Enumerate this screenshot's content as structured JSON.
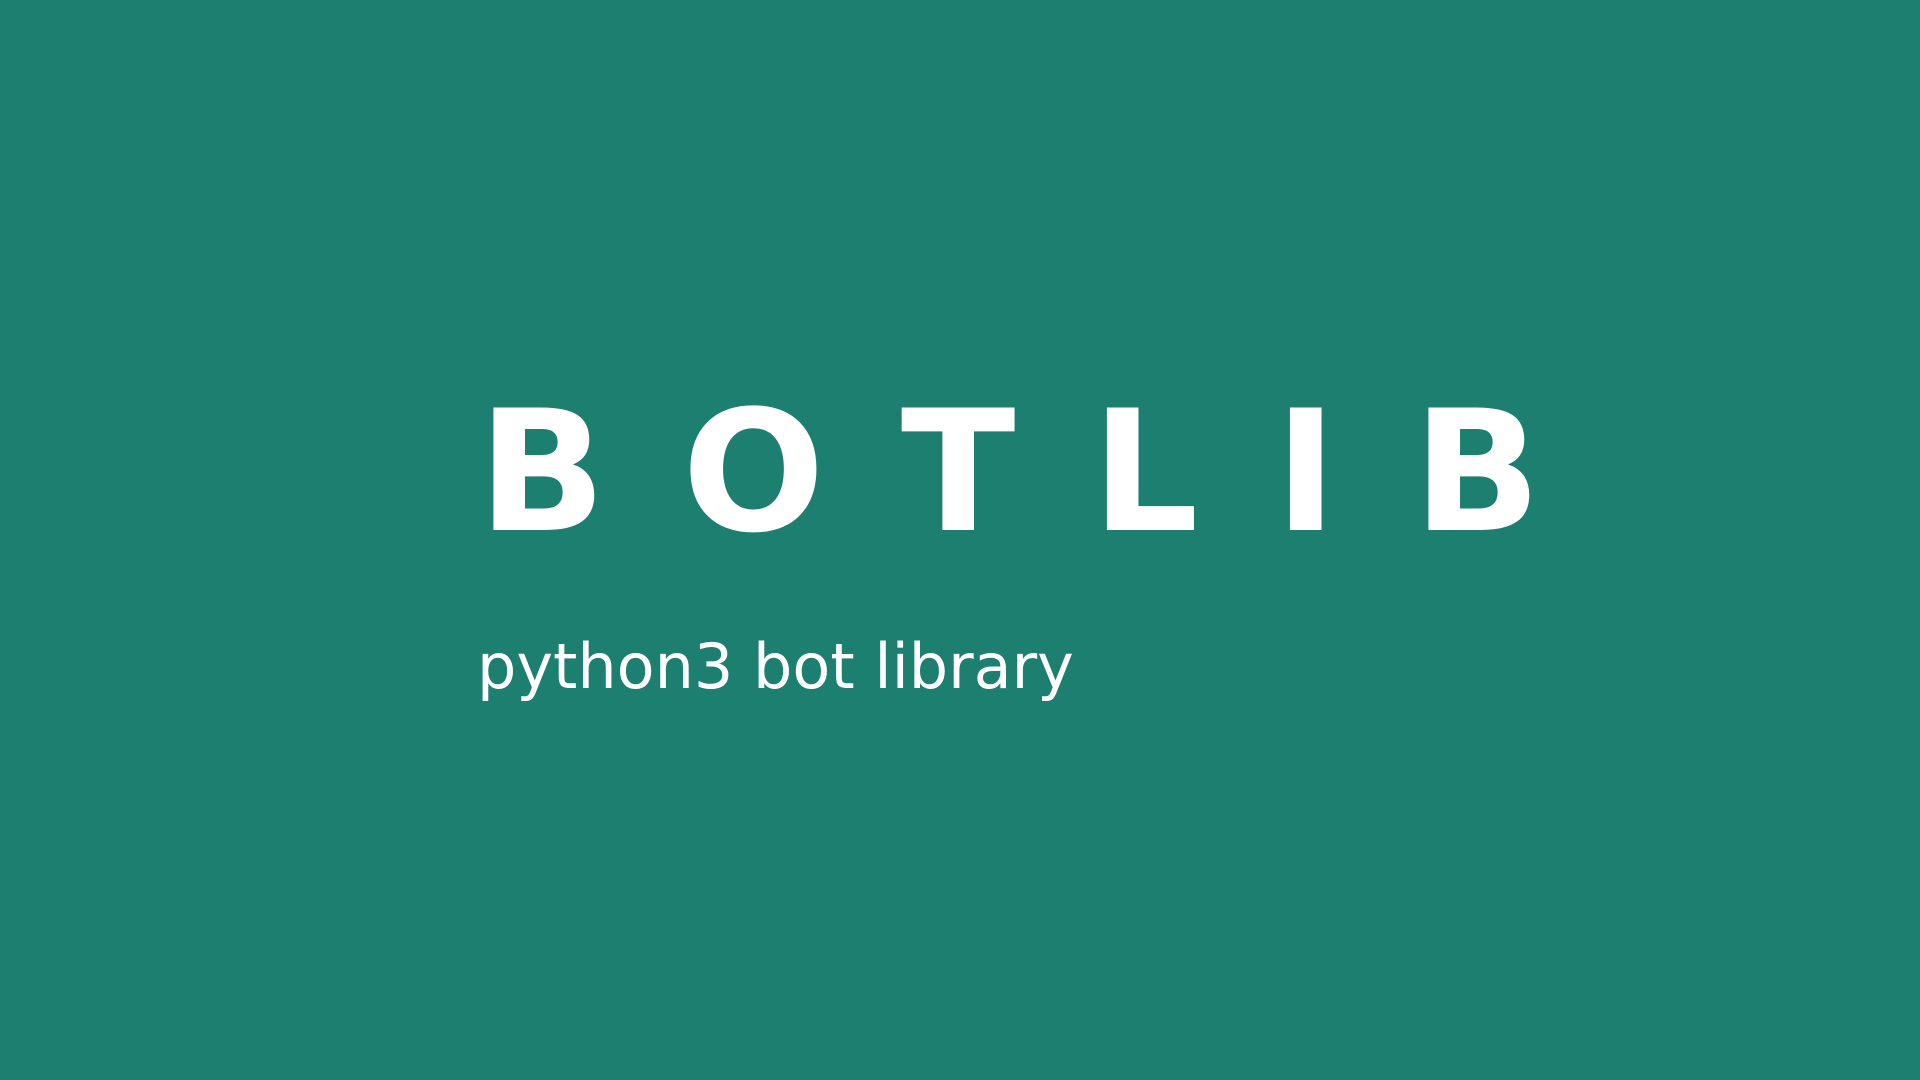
{
  "slide": {
    "title": "BOTLIB",
    "subtitle": "python3 bot library",
    "colors": {
      "background": "#1c7f70",
      "text": "#ffffff"
    }
  }
}
